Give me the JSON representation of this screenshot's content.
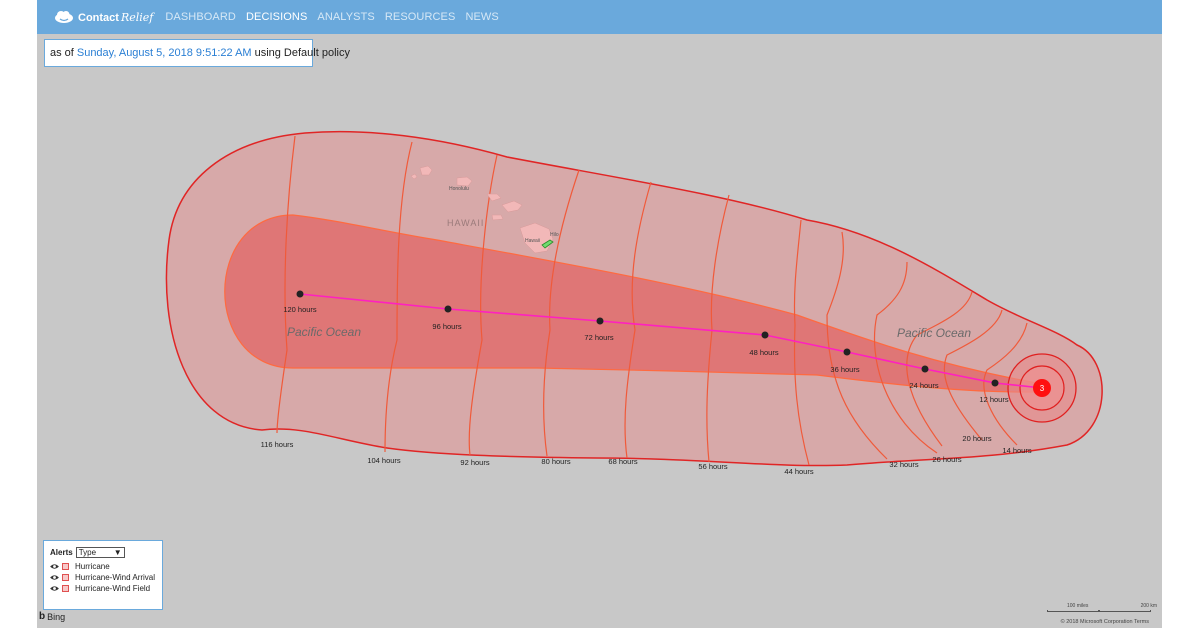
{
  "brand": {
    "name": "Contact",
    "name_em": "Relief"
  },
  "nav": {
    "items": [
      "DASHBOARD",
      "DECISIONS",
      "ANALYSTS",
      "RESOURCES",
      "NEWS"
    ],
    "active": "DECISIONS"
  },
  "status": {
    "prefix": "as of",
    "timestamp": "Sunday, August 5, 2018 9:51:22 AM",
    "suffix": "using Default policy"
  },
  "map": {
    "ocean_labels": [
      "Pacific Ocean",
      "Pacific Ocean"
    ],
    "state_label": "HAWAII",
    "place_labels": [
      "Honolulu",
      "Hilo",
      "Hawaii"
    ],
    "storm_category": "3",
    "track_labels": [
      "120 hours",
      "96 hours",
      "72 hours",
      "48 hours",
      "36 hours",
      "24 hours",
      "12 hours"
    ],
    "arrival_labels": [
      "116 hours",
      "104 hours",
      "92 hours",
      "80 hours",
      "68 hours",
      "56 hours",
      "44 hours",
      "32 hours",
      "26 hours",
      "20 hours",
      "14 hours"
    ],
    "colors": {
      "ocean": "#c8c8c8",
      "wind_field_fill": "#d8a0a0",
      "wind_field_stroke": "#e02020",
      "cone_fill": "#e07878",
      "track": "#ff20c0",
      "storm": "#ff1010"
    }
  },
  "legend": {
    "title": "Alerts",
    "select_value": "Type",
    "items": [
      "Hurricane",
      "Hurricane-Wind Arrival",
      "Hurricane-Wind Field"
    ]
  },
  "footer": {
    "bing": "Bing",
    "scale_miles": "100 miles",
    "scale_km": "200 km",
    "copyright": "© 2018 Microsoft Corporation  Terms"
  }
}
